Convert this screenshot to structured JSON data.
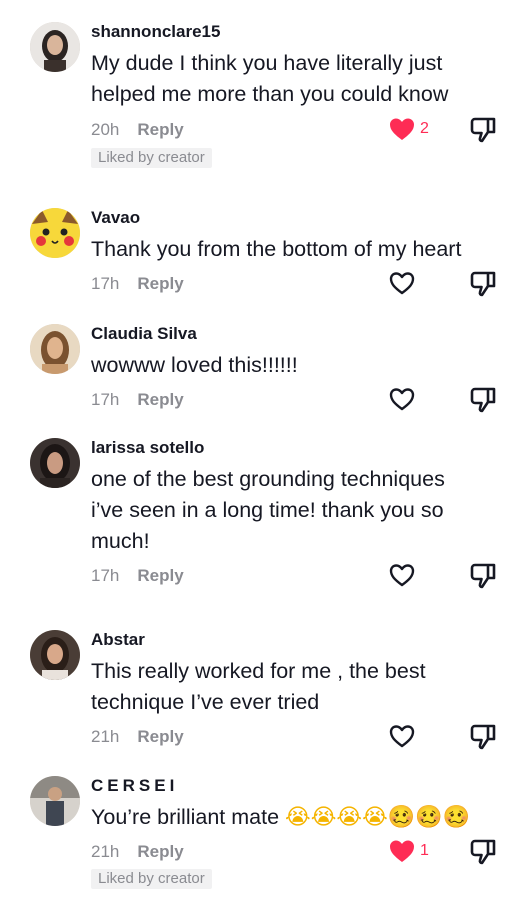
{
  "comments": [
    {
      "username": "shannonclare15",
      "text": "My dude I think you have literally just helped me more than you could know",
      "time": "20h",
      "reply_label": "Reply",
      "likes": "2",
      "liked": true,
      "liked_by_creator": "Liked by creator",
      "avatar_icon": "avatar-photo"
    },
    {
      "username": "Vavao",
      "text": "Thank you from the bottom of my heart",
      "time": "17h",
      "reply_label": "Reply",
      "likes": "",
      "liked": false,
      "avatar_icon": "avatar-pikachu"
    },
    {
      "username": "Claudia Silva",
      "text": "wowww loved this!!!!!!",
      "time": "17h",
      "reply_label": "Reply",
      "likes": "",
      "liked": false,
      "avatar_icon": "avatar-photo"
    },
    {
      "username": "larissa sotello",
      "text": "one of the best grounding techniques i’ve seen in a long time! thank you so much!",
      "time": "17h",
      "reply_label": "Reply",
      "likes": "",
      "liked": false,
      "avatar_icon": "avatar-photo"
    },
    {
      "username": "Abstar",
      "text": "This really worked for me , the best technique I’ve ever tried",
      "time": "21h",
      "reply_label": "Reply",
      "likes": "",
      "liked": false,
      "avatar_icon": "avatar-photo"
    },
    {
      "username": "CERSEI",
      "text": "You’re brilliant mate",
      "text_emoji": "😭😭😭😭🥴🥴🥴",
      "time": "21h",
      "reply_label": "Reply",
      "likes": "1",
      "liked": true,
      "liked_by_creator": "Liked by creator",
      "avatar_icon": "avatar-photo"
    }
  ],
  "icons": {
    "like": "heart-icon",
    "dislike": "thumbs-down-icon"
  },
  "colors": {
    "liked_heart": "#fe2c55",
    "text": "#161823",
    "secondary_text": "#8a8b91",
    "badge_bg": "#f1f1f2"
  }
}
